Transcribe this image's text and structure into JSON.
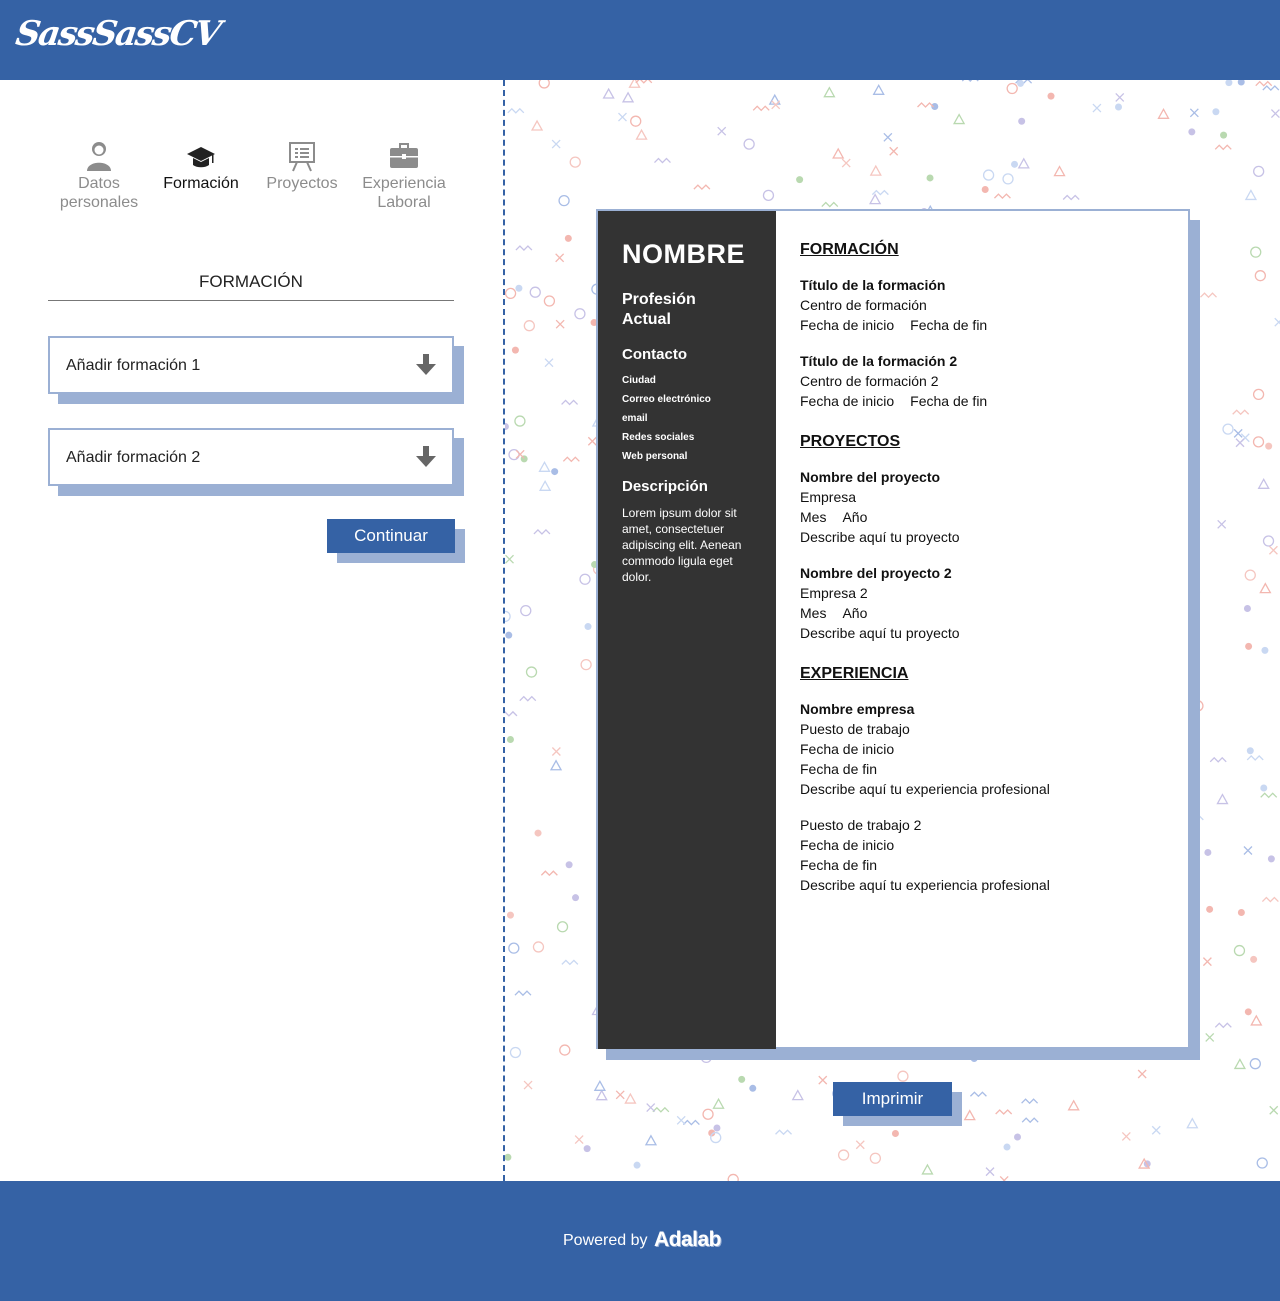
{
  "header": {
    "logo": "SassSassCV"
  },
  "steps": [
    {
      "label1": "Datos",
      "label2": "personales",
      "active": false
    },
    {
      "label1": "Formación",
      "label2": "",
      "active": true
    },
    {
      "label1": "Proyectos",
      "label2": "",
      "active": false
    },
    {
      "label1": "Experiencia",
      "label2": "Laboral",
      "active": false
    }
  ],
  "form": {
    "section_title": "FORMACIÓN",
    "accordions": [
      "Añadir formación 1",
      "Añadir formación 2"
    ],
    "continue_label": "Continuar"
  },
  "cv": {
    "name": "NOMBRE",
    "profession_line1": "Profesión",
    "profession_line2": "Actual",
    "contact_title": "Contacto",
    "contact": [
      "Ciudad",
      "Correo electrónico",
      "email",
      "Redes sociales",
      "Web personal"
    ],
    "description_title": "Descripción",
    "description": "Lorem ipsum dolor sit amet, consectetuer adipiscing elit. Aenean commodo ligula eget dolor.",
    "formacion_title": "FORMACIÓN",
    "formacion": [
      {
        "title": "Título de la formación",
        "center": "Centro de formación",
        "start": "Fecha de inicio",
        "end": "Fecha de fin"
      },
      {
        "title": "Título de la formación 2",
        "center": "Centro de formación 2",
        "start": "Fecha de inicio",
        "end": "Fecha de fin"
      }
    ],
    "proyectos_title": "PROYECTOS",
    "proyectos": [
      {
        "name": "Nombre del proyecto",
        "company": "Empresa",
        "month": "Mes",
        "year": "Año",
        "desc": "Describe aquí tu proyecto"
      },
      {
        "name": "Nombre del proyecto 2",
        "company": "Empresa 2",
        "month": "Mes",
        "year": "Año",
        "desc": "Describe aquí tu proyecto"
      }
    ],
    "experiencia_title": "EXPERIENCIA",
    "experiencia_company": "Nombre empresa",
    "experiencia": [
      {
        "position": "Puesto de trabajo",
        "start": "Fecha de inicio",
        "end": "Fecha de fin",
        "desc": "Describe aquí tu experiencia profesional"
      },
      {
        "position": "Puesto de trabajo 2",
        "start": "Fecha de inicio",
        "end": "Fecha de fin",
        "desc": "Describe aquí tu experiencia profesional"
      }
    ]
  },
  "print_label": "Imprimir",
  "footer": {
    "powered": "Powered by",
    "brand": "Adalab"
  },
  "colors": {
    "primary": "#3562a5",
    "shadow": "#9bb0d4",
    "cv_sidebar": "#333333"
  }
}
